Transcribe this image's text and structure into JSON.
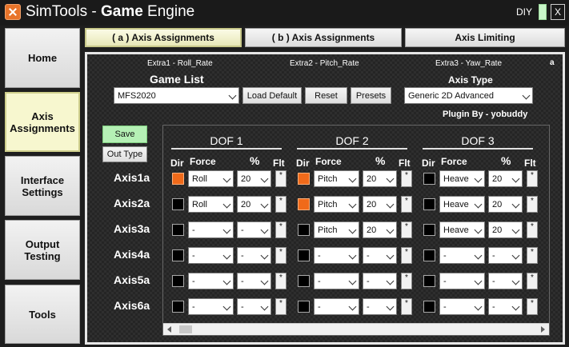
{
  "app": {
    "title_prefix": "SimTools - ",
    "title_bold": "Game",
    "title_suffix": " Engine",
    "diy": "DIY",
    "close": "X"
  },
  "sidebar": {
    "items": [
      {
        "label": "Home"
      },
      {
        "label": "Axis Assignments",
        "active": true
      },
      {
        "label": "Interface Settings"
      },
      {
        "label": "Output Testing"
      },
      {
        "label": "Tools"
      }
    ]
  },
  "tabs": [
    {
      "label": "( a ) Axis Assignments",
      "active": true
    },
    {
      "label": "( b ) Axis Assignments"
    },
    {
      "label": "Axis Limiting"
    }
  ],
  "panel": {
    "extras": [
      "Extra1 - Roll_Rate",
      "Extra2 - Pitch_Rate",
      "Extra3 - Yaw_Rate"
    ],
    "corner_tag": "a",
    "game_list_label": "Game List",
    "game_value": "MFS2020",
    "load_default": "Load Default",
    "reset": "Reset",
    "presets": "Presets",
    "axis_type_label": "Axis Type",
    "axis_type_value": "Generic 2D Advanced",
    "plugin_by": "Plugin By - yobuddy",
    "save": "Save",
    "out_type": "Out Type"
  },
  "grid": {
    "dof_titles": [
      "DOF 1",
      "DOF 2",
      "DOF 3"
    ],
    "col_dir": "Dir",
    "col_force": "Force",
    "col_pct": "%",
    "col_flt": "Flt",
    "flt_symbol": "*",
    "axes": [
      {
        "label": "Axis1a",
        "dofs": [
          {
            "dir_on": true,
            "force": "Roll",
            "pct": "20"
          },
          {
            "dir_on": true,
            "force": "Pitch",
            "pct": "20"
          },
          {
            "dir_on": false,
            "force": "Heave",
            "pct": "20"
          }
        ]
      },
      {
        "label": "Axis2a",
        "dofs": [
          {
            "dir_on": false,
            "force": "Roll",
            "pct": "20"
          },
          {
            "dir_on": true,
            "force": "Pitch",
            "pct": "20"
          },
          {
            "dir_on": false,
            "force": "Heave",
            "pct": "20"
          }
        ]
      },
      {
        "label": "Axis3a",
        "dofs": [
          {
            "dir_on": false,
            "force": "-",
            "pct": "-"
          },
          {
            "dir_on": false,
            "force": "Pitch",
            "pct": "20"
          },
          {
            "dir_on": false,
            "force": "Heave",
            "pct": "20"
          }
        ]
      },
      {
        "label": "Axis4a",
        "dofs": [
          {
            "dir_on": false,
            "force": "-",
            "pct": "-"
          },
          {
            "dir_on": false,
            "force": "-",
            "pct": "-"
          },
          {
            "dir_on": false,
            "force": "-",
            "pct": "-"
          }
        ]
      },
      {
        "label": "Axis5a",
        "dofs": [
          {
            "dir_on": false,
            "force": "-",
            "pct": "-"
          },
          {
            "dir_on": false,
            "force": "-",
            "pct": "-"
          },
          {
            "dir_on": false,
            "force": "-",
            "pct": "-"
          }
        ]
      },
      {
        "label": "Axis6a",
        "dofs": [
          {
            "dir_on": false,
            "force": "-",
            "pct": "-"
          },
          {
            "dir_on": false,
            "force": "-",
            "pct": "-"
          },
          {
            "dir_on": false,
            "force": "-",
            "pct": "-"
          }
        ]
      }
    ]
  },
  "colors": {
    "dir_active": "#f06a1a",
    "save_green": "#b5f0b5",
    "active_tab": "#f7f7cf"
  }
}
